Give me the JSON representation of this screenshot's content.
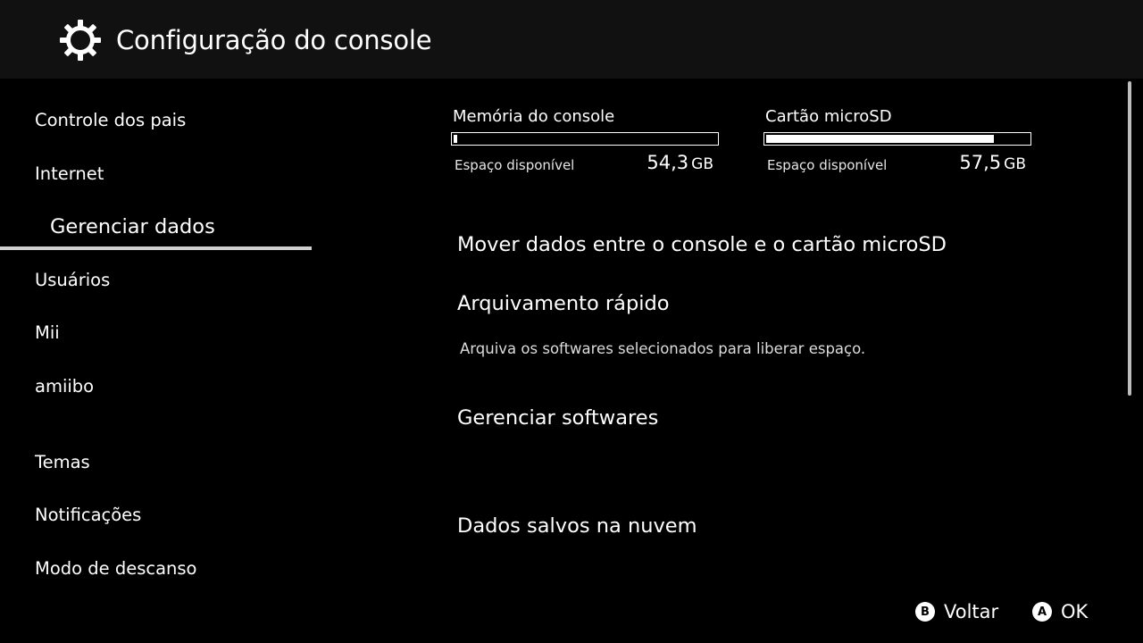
{
  "header": {
    "title": "Configuração do console",
    "icon": "gear-icon"
  },
  "sidebar": {
    "items": [
      {
        "label": "Controle dos pais",
        "selected": false
      },
      {
        "label": "Internet",
        "selected": false
      },
      {
        "label": "Gerenciar dados",
        "selected": true
      },
      {
        "label": "Usuários",
        "selected": false
      },
      {
        "label": "Mii",
        "selected": false
      },
      {
        "label": "amiibo",
        "selected": false
      },
      {
        "label": "Temas",
        "selected": false
      },
      {
        "label": "Notificações",
        "selected": false
      },
      {
        "label": "Modo de descanso",
        "selected": false
      }
    ]
  },
  "storage": {
    "console": {
      "label": "Memória do console",
      "available_label": "Espaço disponível",
      "available_value": "54,3",
      "unit": "GB",
      "used_fraction": 0.01
    },
    "microsd": {
      "label": "Cartão microSD",
      "available_label": "Espaço disponível",
      "available_value": "57,5",
      "unit": "GB",
      "used_fraction": 0.87
    }
  },
  "options": {
    "move": {
      "label": "Mover dados entre o console e o cartão microSD"
    },
    "archive": {
      "label": "Arquivamento rápido",
      "description": "Arquiva os softwares selecionados para liberar espaço."
    },
    "software": {
      "label": "Gerenciar softwares"
    },
    "cloud": {
      "label": "Dados salvos na nuvem"
    }
  },
  "footer": {
    "back": {
      "key": "B",
      "label": "Voltar"
    },
    "ok": {
      "key": "A",
      "label": "OK"
    }
  }
}
